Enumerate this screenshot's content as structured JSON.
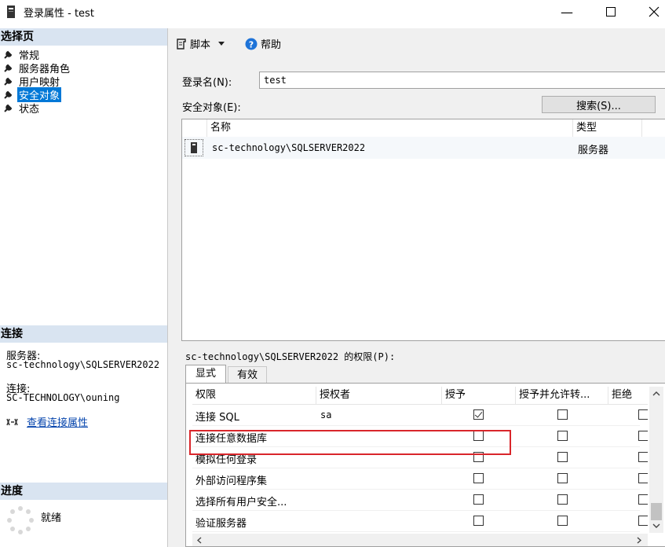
{
  "window": {
    "title": "登录属性 - test"
  },
  "left": {
    "select_page_header": "选择页",
    "nav_items": [
      {
        "label": "常规"
      },
      {
        "label": "服务器角色"
      },
      {
        "label": "用户映射"
      },
      {
        "label": "安全对象",
        "selected": true
      },
      {
        "label": "状态"
      }
    ],
    "connection_header": "连接",
    "server_label": "服务器:",
    "server_value": "sc-technology\\SQLSERVER2022",
    "connection_label": "连接:",
    "connection_value": "SC-TECHNOLOGY\\ouning",
    "view_conn_props": "查看连接属性",
    "progress_header": "进度",
    "progress_status": "就绪"
  },
  "toolbar": {
    "script_label": "脚本",
    "help_label": "帮助"
  },
  "login": {
    "label": "登录名(N):",
    "value": "test",
    "securables_label": "安全对象(E):",
    "search_button": "搜索(S)..."
  },
  "securables": {
    "columns": [
      "名称",
      "类型"
    ],
    "rows": [
      {
        "name": "sc-technology\\SQLSERVER2022",
        "type": "服务器"
      }
    ]
  },
  "permissions": {
    "label": "sc-technology\\SQLSERVER2022 的权限(P):",
    "tabs": [
      "显式",
      "有效"
    ],
    "columns": [
      "权限",
      "授权者",
      "授予",
      "授予并允许转...",
      "拒绝"
    ],
    "rows": [
      {
        "permission": "连接 SQL",
        "grantor": "sa",
        "grant": true,
        "with_grant": false,
        "deny": false
      },
      {
        "permission": "连接任意数据库",
        "grantor": "",
        "grant": false,
        "with_grant": false,
        "deny": false
      },
      {
        "permission": "模拟任何登录",
        "grantor": "",
        "grant": false,
        "with_grant": false,
        "deny": false
      },
      {
        "permission": "外部访问程序集",
        "grantor": "",
        "grant": false,
        "with_grant": false,
        "deny": false
      },
      {
        "permission": "选择所有用户安全...",
        "grantor": "",
        "grant": false,
        "with_grant": false,
        "deny": false
      },
      {
        "permission": "验证服务器",
        "grantor": "",
        "grant": false,
        "with_grant": false,
        "deny": false
      }
    ]
  },
  "colors": {
    "highlight_box": "#d9262b",
    "selection": "#0078d7",
    "section_header": "#d9e4f1"
  },
  "icons": {
    "help": "help-icon",
    "script": "script-icon",
    "app": "app-icon"
  }
}
